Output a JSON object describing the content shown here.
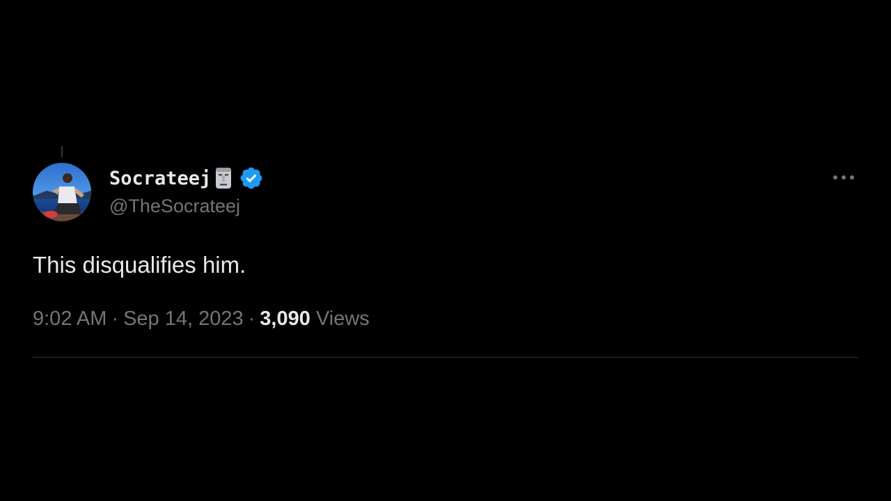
{
  "tweet": {
    "author": {
      "display_name": "Socrateej",
      "name_emoji": "moai-icon",
      "handle": "@TheSocrateej",
      "verified": true,
      "badge_color": "#1d9bf0"
    },
    "text": "This disqualifies him.",
    "time": "9:02 AM",
    "date": "Sep 14, 2023",
    "separator": "·",
    "views_count": "3,090",
    "views_label": "Views",
    "more_icon": "more-horizontal-icon"
  },
  "colors": {
    "background": "#000000",
    "primary_text": "#e7e9ea",
    "secondary_text": "#71767b",
    "divider": "#2f3336"
  }
}
